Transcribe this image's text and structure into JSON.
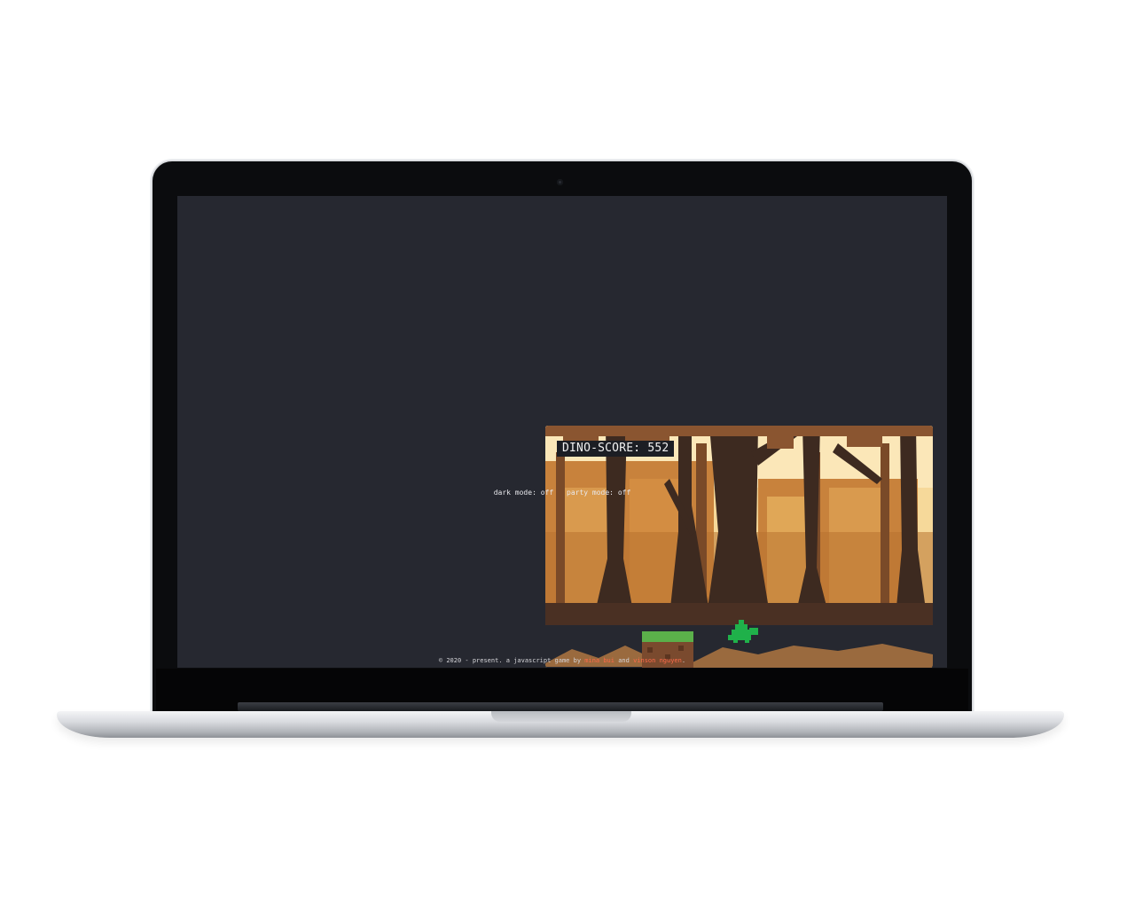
{
  "game": {
    "score_label": "DINO-SCORE:",
    "score": 552,
    "colors": {
      "sky": "#f6d99a",
      "trunk_dark": "#3d2a20",
      "foliage": "#c8823c",
      "ground": "#262830",
      "grass": "#5bb04a",
      "dirt": "#7a4a2e",
      "dino": "#1fb14a"
    }
  },
  "toggles": {
    "dark_mode": {
      "label": "dark mode:",
      "value": "off"
    },
    "party_mode": {
      "label": "party mode:",
      "value": "off"
    }
  },
  "footer": {
    "prefix": "© 2020 - present. a javascript game by",
    "author1": "mina bui",
    "joiner": "and",
    "author2": "vinson nguyen",
    "suffix": ".",
    "link_color": "#ff6b4a"
  }
}
